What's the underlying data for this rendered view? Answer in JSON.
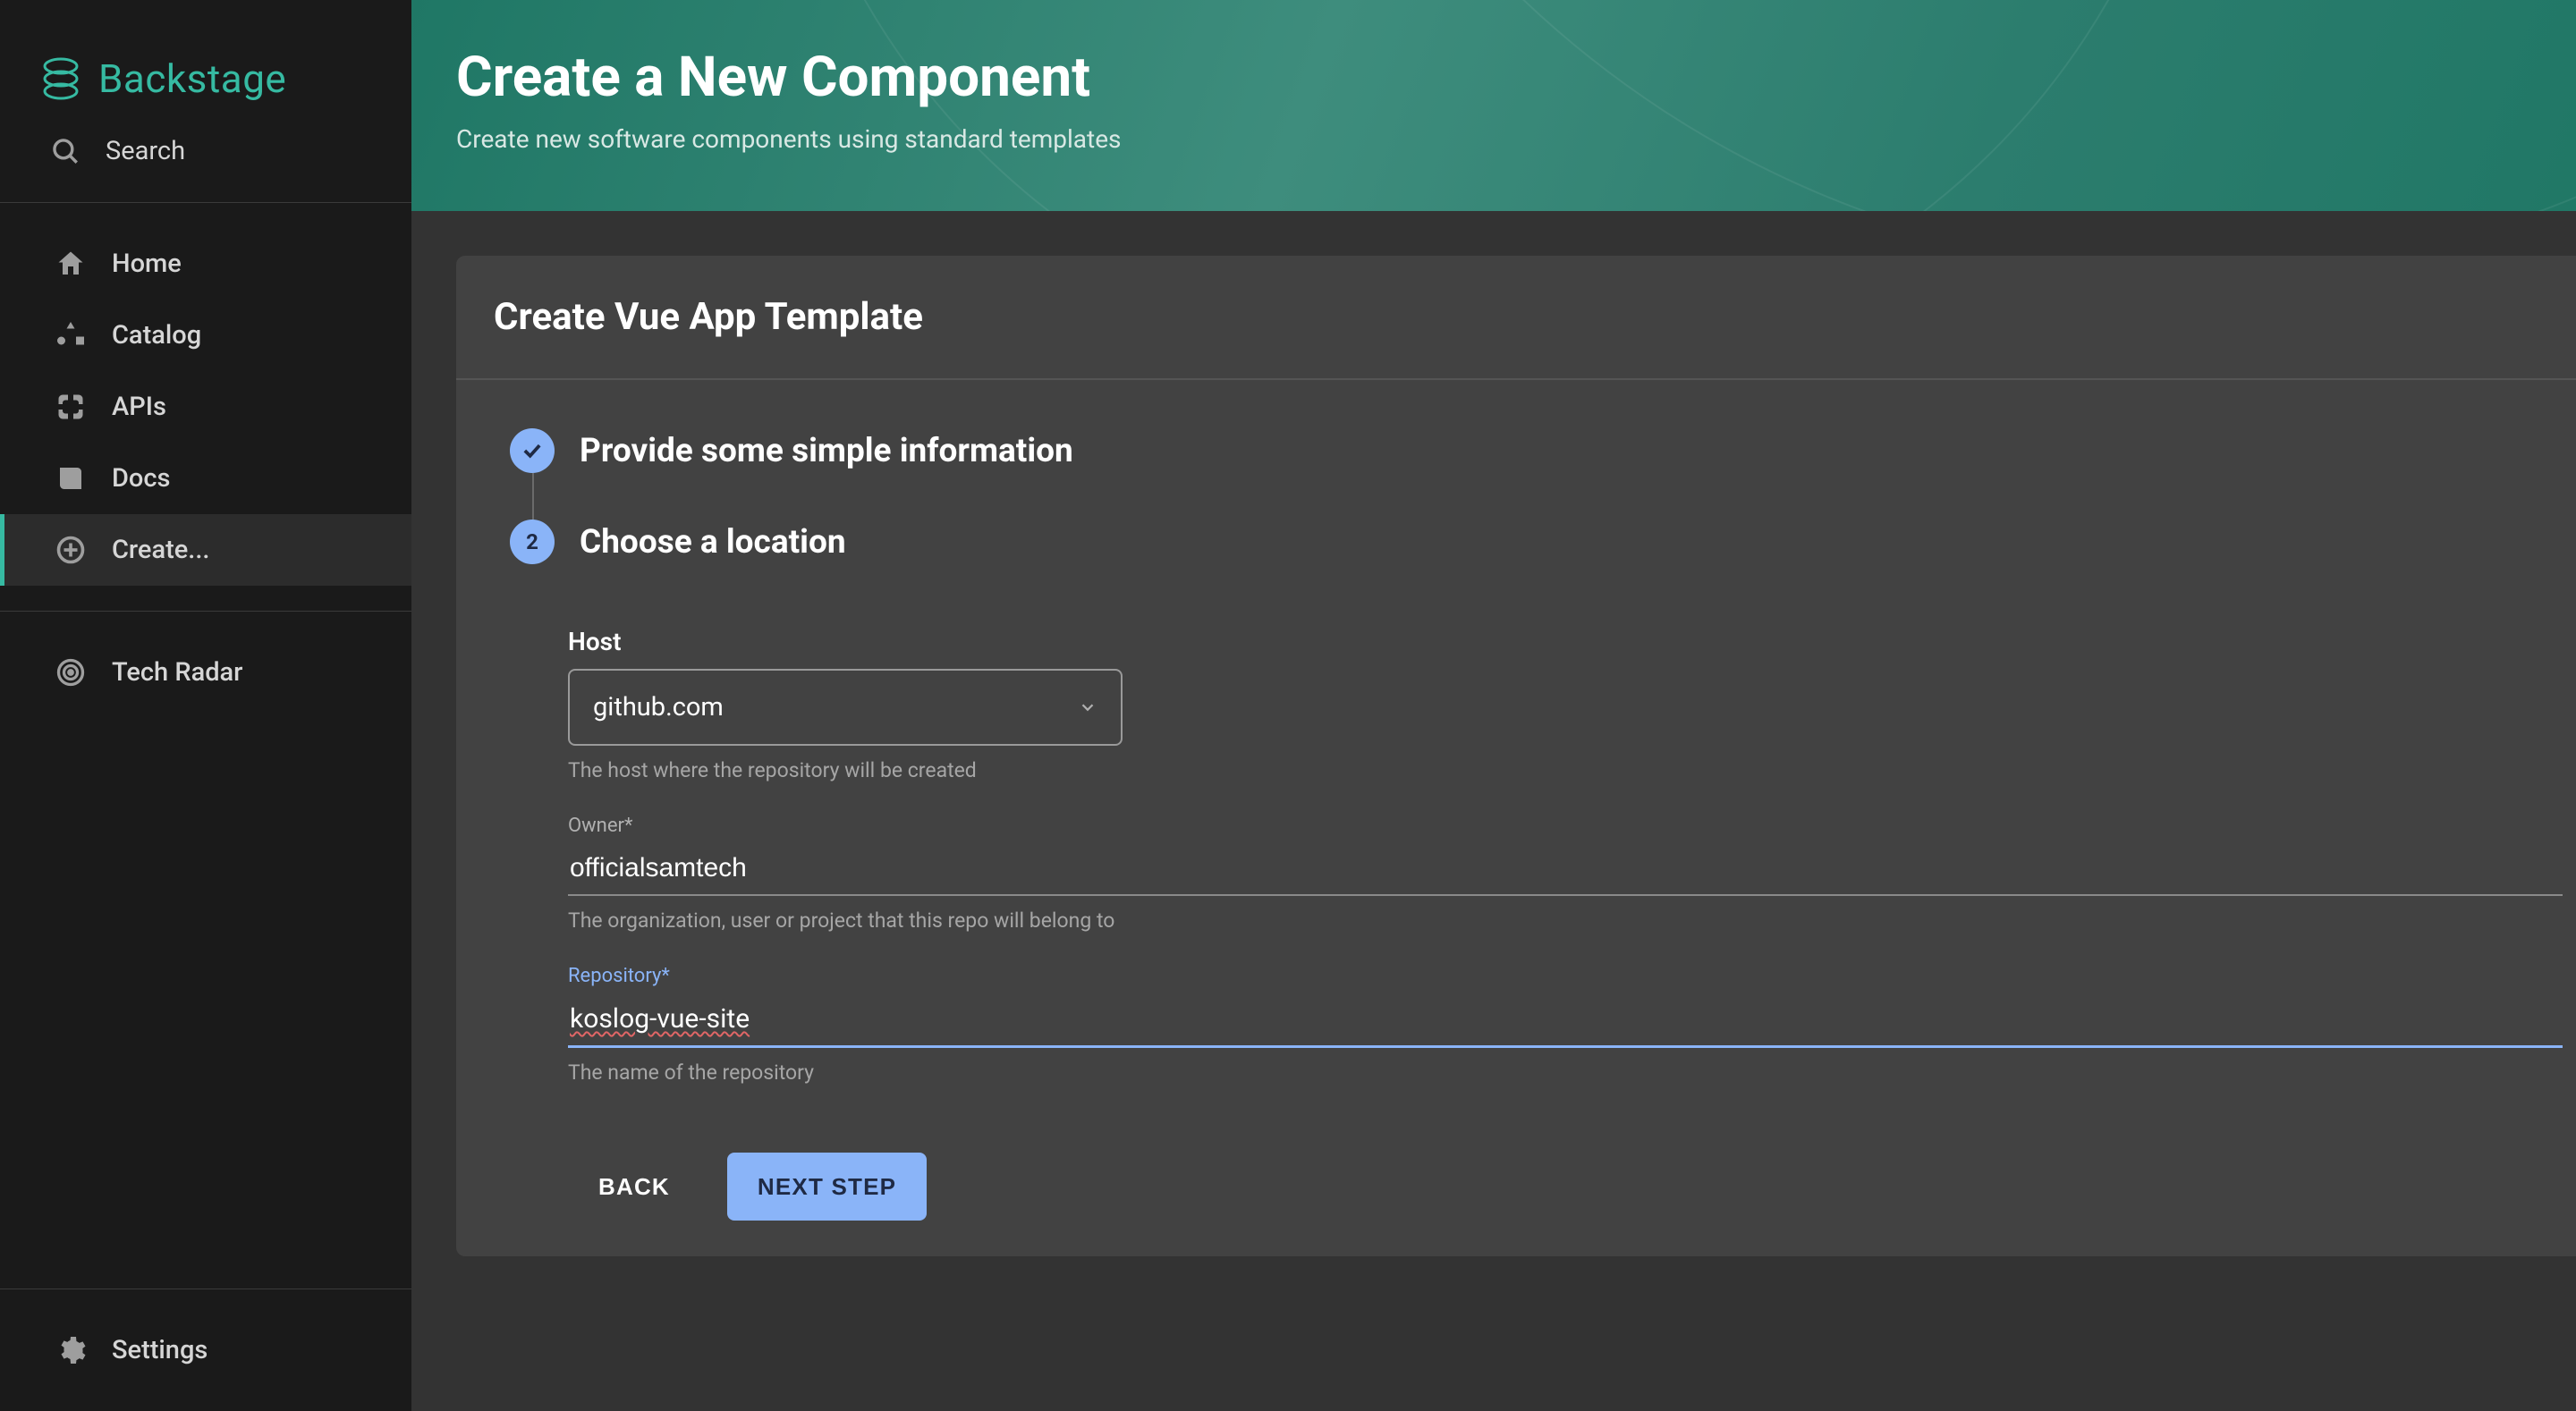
{
  "brand": {
    "name": "Backstage"
  },
  "search": {
    "placeholder": "Search"
  },
  "nav": {
    "home": "Home",
    "catalog": "Catalog",
    "apis": "APIs",
    "docs": "Docs",
    "create": "Create...",
    "techradar": "Tech Radar",
    "settings": "Settings"
  },
  "header": {
    "title": "Create a New Component",
    "subtitle": "Create new software components using standard templates"
  },
  "card": {
    "title": "Create Vue App Template"
  },
  "steps": {
    "step1": {
      "title": "Provide some simple information"
    },
    "step2": {
      "number": "2",
      "title": "Choose a location"
    }
  },
  "form": {
    "host": {
      "label": "Host",
      "value": "github.com",
      "help": "The host where the repository will be created"
    },
    "owner": {
      "label": "Owner*",
      "value": "officialsamtech",
      "help": "The organization, user or project that this repo will belong to"
    },
    "repository": {
      "label": "Repository*",
      "value": "koslog-vue-site",
      "help": "The name of the repository"
    }
  },
  "buttons": {
    "back": "BACK",
    "next": "NEXT STEP"
  }
}
